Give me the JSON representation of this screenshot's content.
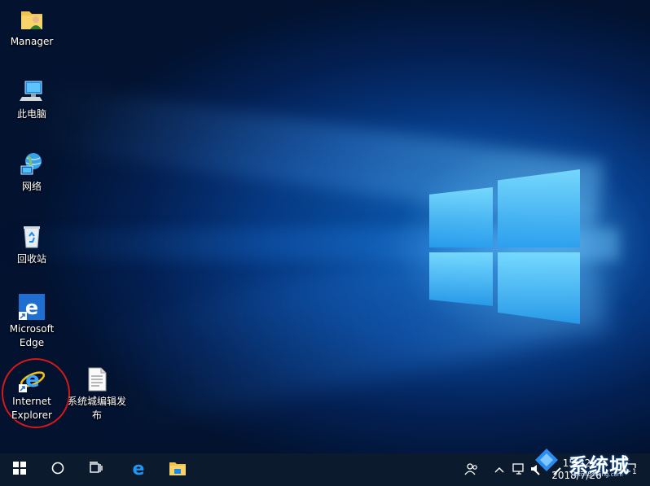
{
  "desktop": {
    "icons": [
      {
        "label": "Manager",
        "icon": "user-folder-icon"
      },
      {
        "label": "此电脑",
        "icon": "computer-icon"
      },
      {
        "label": "网络",
        "icon": "network-icon"
      },
      {
        "label": "回收站",
        "icon": "recycle-bin-icon"
      },
      {
        "label": "Microsoft\nEdge",
        "icon": "edge-icon"
      },
      {
        "label": "Internet\nExplorer",
        "icon": "internet-explorer-icon"
      },
      {
        "label": "系统城编辑发\n布",
        "icon": "text-file-icon"
      }
    ]
  },
  "taskbar": {
    "start_icon": "windows-start-icon",
    "search_icon": "cortana-circle-icon",
    "taskview_icon": "task-view-icon",
    "pinned": [
      "edge-icon",
      "file-explorer-icon"
    ],
    "tray": {
      "people_icon": "people-icon",
      "chevron_icon": "chevron-up-icon",
      "network_icon": "network-tray-icon",
      "volume_icon": "volume-icon",
      "time": "15:22",
      "date": "2018/7/26",
      "notification_count": "1"
    }
  },
  "watermark": {
    "text": "系统城",
    "sub": "xitongcheng.com"
  },
  "colors": {
    "taskbar": "#0c1a2d",
    "highlight": "#d71818",
    "edge_blue": "#1e88e5",
    "folder_yellow": "#f2c14e"
  }
}
